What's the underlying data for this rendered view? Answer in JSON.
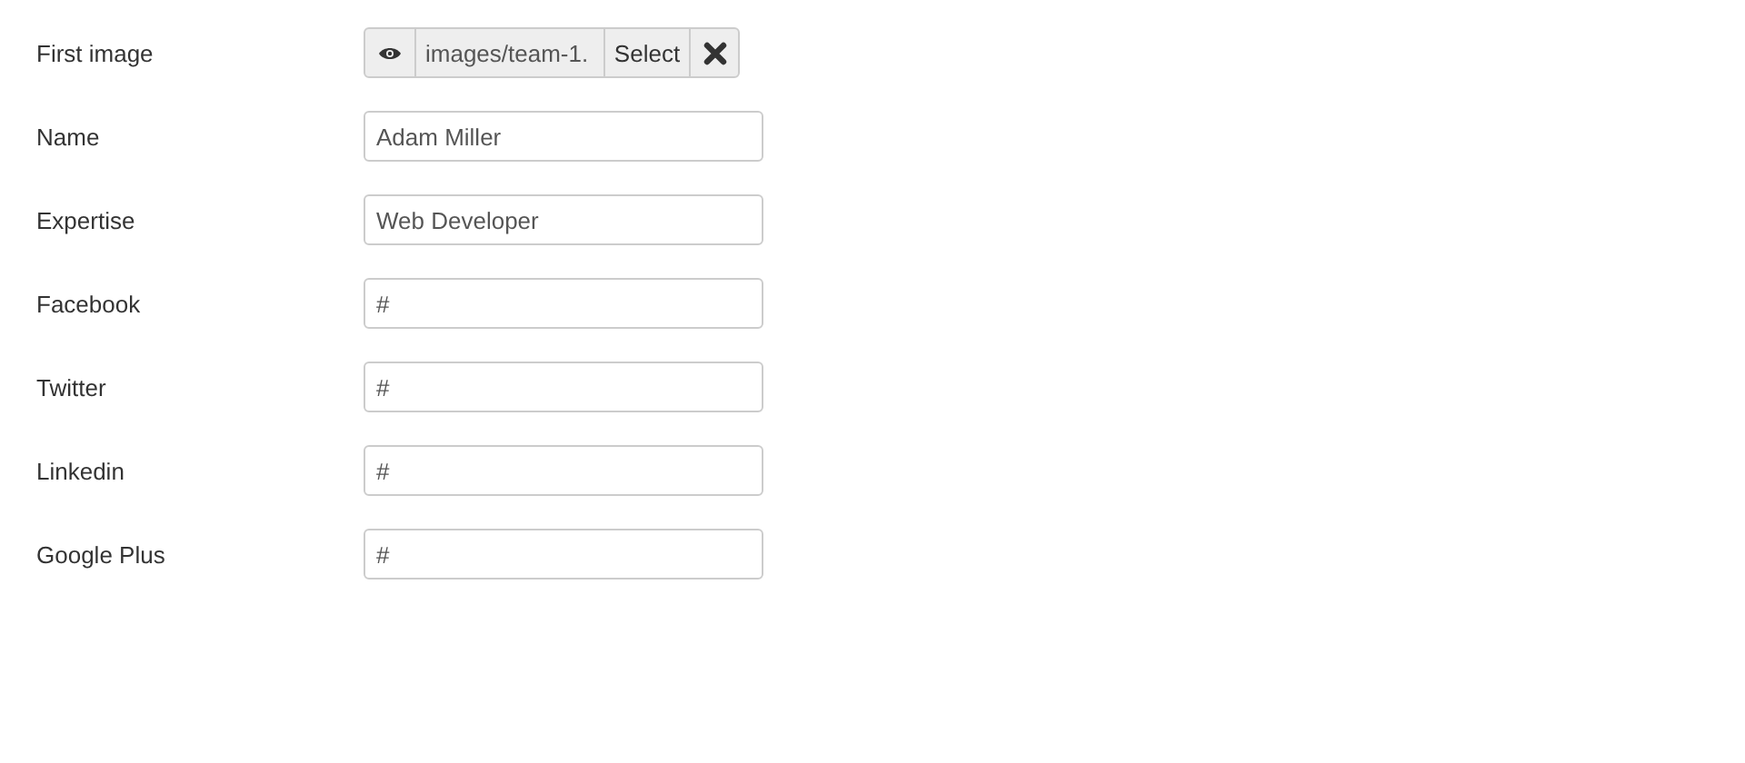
{
  "fields": [
    {
      "kind": "media",
      "label": "First image",
      "value": "images/team-1.",
      "select_label": "Select"
    },
    {
      "kind": "text",
      "label": "Name",
      "value": "Adam Miller"
    },
    {
      "kind": "text",
      "label": "Expertise",
      "value": "Web Developer"
    },
    {
      "kind": "text",
      "label": "Facebook",
      "value": "#"
    },
    {
      "kind": "text",
      "label": "Twitter",
      "value": "#"
    },
    {
      "kind": "text",
      "label": "Linkedin",
      "value": "#"
    },
    {
      "kind": "text",
      "label": "Google Plus",
      "value": "#"
    }
  ]
}
